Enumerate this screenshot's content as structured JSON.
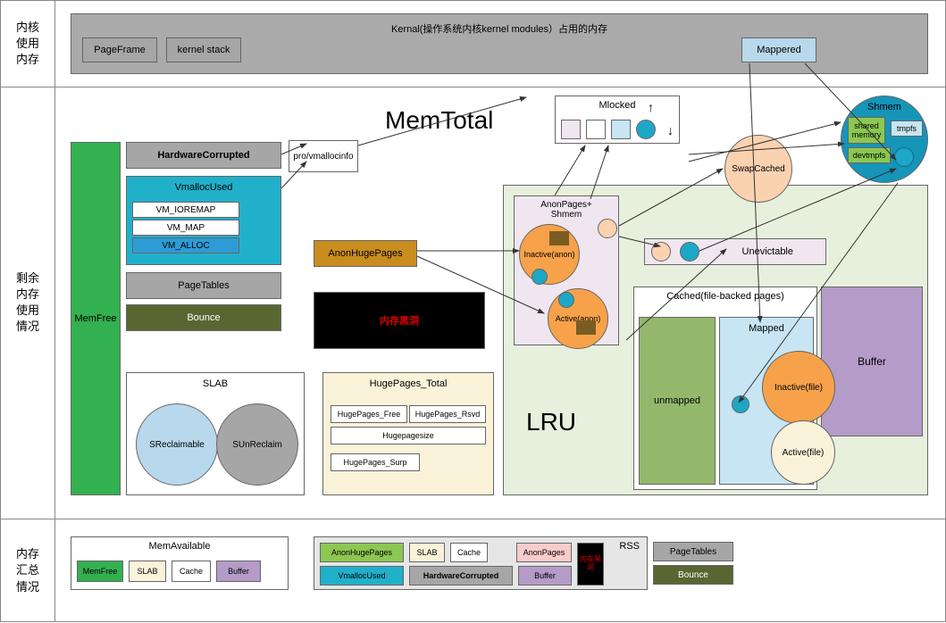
{
  "rows": {
    "kernel": "内核\n使用\n内存",
    "remaining": "剩余\n内存\n使用\n情况",
    "summary": "内存\n汇总\n情况"
  },
  "kernel": {
    "banner": "Kernal(操作系统内核kernel modules）占用的内存",
    "pageFrame": "PageFrame",
    "kernelStack": "kernel stack",
    "mappered": "Mappered"
  },
  "titles": {
    "memTotal": "MemTotal",
    "lru": "LRU"
  },
  "left": {
    "memFree": "MemFree",
    "hwCorrupted": "HardwareCorrupted",
    "vmallocUsed": "VmallocUsed",
    "vmIoremap": "VM_IOREMAP",
    "vmMap": "VM_MAP",
    "vmAlloc": "VM_ALLOC",
    "pageTables": "PageTables",
    "bounce": "Bounce",
    "proVmallocinfo": "pro/vmallocinfo"
  },
  "slab": {
    "title": "SLAB",
    "sreclaim": "SReclaimable",
    "sunreclaim": "SUnReclaim"
  },
  "mid": {
    "anonHugePages": "AnonHugePages",
    "blackhole": "内存黑洞"
  },
  "huge": {
    "title": "HugePages_Total",
    "free": "HugePages_Free",
    "rsvd": "HugePages_Rsvd",
    "size": "Hugepagesize",
    "surp": "HugePages_Surp"
  },
  "mlocked": {
    "title": "Mlocked"
  },
  "anon": {
    "groupTitle": "AnonPages+\nShmem",
    "inactive": "Inactive(anon)",
    "active": "Active(anon)"
  },
  "right": {
    "swapCached": "SwapCached",
    "unevictable": "Unevictable",
    "cachedTitle": "Cached(file-backed pages)",
    "unmapped": "unmapped",
    "mapped": "Mapped",
    "buffer": "Buffer",
    "inactiveFile": "Inactive(file)",
    "activeFile": "Active(file)"
  },
  "shmem": {
    "title": "Shmem",
    "shared": "shared\nmemory",
    "tmpfs": "tmpfs",
    "devtmpfs": "devtmpfs"
  },
  "summary": {
    "memAvailable": "MemAvailable",
    "memFree": "MemFree",
    "slab": "SLAB",
    "cache": "Cache",
    "buffer": "Buffer",
    "rss": "RSS",
    "anonHugePages": "AnonHugePages",
    "slab2": "SLAB",
    "cache2": "Cache",
    "anonPages": "AnonPages",
    "blackhole": "内存黑洞",
    "vmallocUsed": "VmallocUsed",
    "hwCorrupted": "HardwareCorrupted",
    "buffer2": "Buffer",
    "pageTables": "PageTables",
    "bounce": "Bounce"
  },
  "colors": {
    "grayBanner": "#aaaaaa",
    "grayBox": "#a6a6a6",
    "lightBlue": "#b8d8eb",
    "green": "#33b050",
    "teal": "#21b0ca",
    "tealDark": "#1f90a8",
    "blueAlloc": "#2e9bd6",
    "olive": "#5a6632",
    "gold": "#c98d1f",
    "black": "#000000",
    "cream": "#faf2d9",
    "lavender": "#efe6f0",
    "lightGreen": "#e7f0dd",
    "orange": "#f7a24a",
    "peach": "#fbd2b0",
    "purple": "#b49bc8",
    "blueMap": "#c7e5f2",
    "greenMap": "#93b86c",
    "cyanDot": "#1da7c7",
    "shmemBlue": "#1595b8",
    "shmemGreen": "#8cc751",
    "salmon": "#f9cccc",
    "ltGray": "#e6e6e6"
  }
}
